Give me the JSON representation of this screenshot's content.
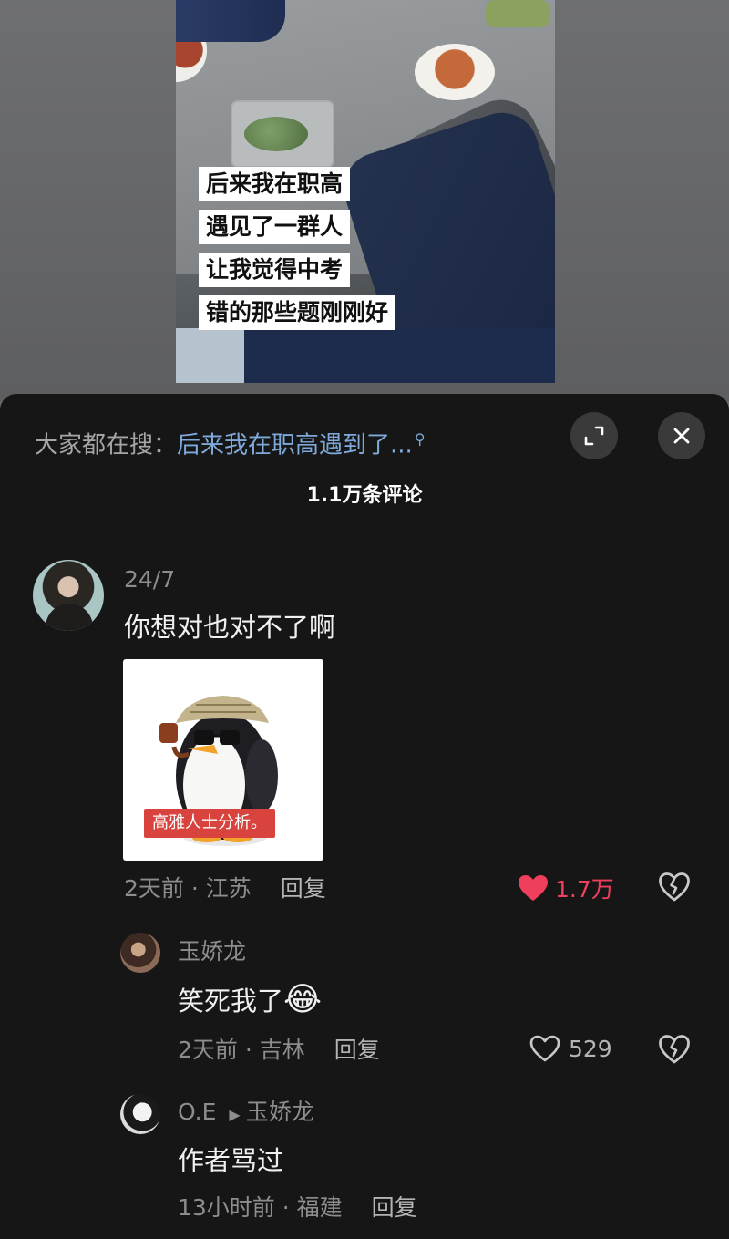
{
  "video": {
    "caption_lines": [
      "后来我在职高",
      "遇见了一群人",
      "让我觉得中考",
      "错的那些题刚刚好"
    ]
  },
  "search_bar": {
    "prefix": "大家都在搜：",
    "query": "后来我在职高遇到了...",
    "icon": "search-icon"
  },
  "header": {
    "comment_count": "1.1万条评论",
    "expand_icon": "expand-icon",
    "close_icon": "close-icon"
  },
  "comments": [
    {
      "username": "24/7",
      "text": "你想对也对不了啊",
      "sticker_text": "高雅人士分析。",
      "meta": "2天前 · 江苏",
      "reply_label": "回复",
      "likes": "1.7万",
      "liked": true
    },
    {
      "username": "玉娇龙",
      "text": "笑死我了",
      "emoji": "😂",
      "meta": "2天前 · 吉林",
      "reply_label": "回复",
      "likes": "529",
      "liked": false
    },
    {
      "username": "O.E",
      "reply_to": "玉娇龙",
      "text": "作者骂过",
      "meta": "13小时前 · 福建",
      "reply_label": "回复"
    }
  ],
  "colors": {
    "sheet_bg": "#161616",
    "like_active": "#f03f5c",
    "link_blue": "#7fa9d9",
    "muted_text": "#8d8d8d"
  }
}
